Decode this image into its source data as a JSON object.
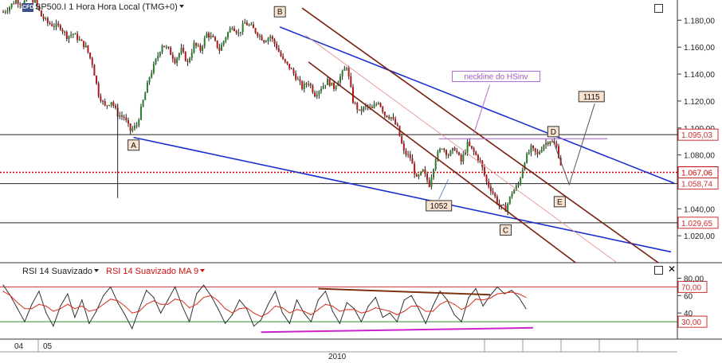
{
  "header": {
    "instrument": "SP500.I",
    "title": "SP500.I 1 Hora Hora Local (TMG+0)",
    "logo_text": "CFD"
  },
  "rsi_panel": {
    "rsi_label": "RSI 14 Suavizado",
    "rsi_ma_label": "RSI 14 Suavizado MA 9"
  },
  "colors": {
    "candle_up": "#2a7a2a",
    "candle_down": "#b01818",
    "trendline_blue": "#1a2fd0",
    "channel_brown": "#7a1f12",
    "rsi_line": "#333333",
    "rsi_ma_line": "#d83020",
    "rsi_trend_top": "#7a3410",
    "rsi_trend_bottom": "#cc22cc",
    "rsi_level_30": "#2f8f2f",
    "rsi_level_70": "#cc3030",
    "price_marker": "#cc0000",
    "neckline": "#b06ad8"
  },
  "chart_data": [
    {
      "type": "candlestick",
      "title": "SP500.I 1 Hora Hora Local (TMG+0)",
      "x_ticks": [
        "04",
        "05"
      ],
      "x_period": "2010",
      "ylim": [
        1000,
        1195
      ],
      "y_ticks": [
        1020,
        1040,
        1060,
        1080,
        1100,
        1120,
        1140,
        1160,
        1180
      ],
      "y_tick_labels": [
        "1.020,00",
        "1.040,00",
        "1.060,00",
        "1.080,00",
        "1.100,00",
        "1.120,00",
        "1.140,00",
        "1.160,00",
        "1.180,00"
      ],
      "price_tags": [
        {
          "label": "1.095,03",
          "value": 1095.03,
          "color": "#cc3030"
        },
        {
          "label": "1.067,06",
          "value": 1067.06,
          "color": "#cc0000"
        },
        {
          "label": "1.058,74",
          "value": 1058.74,
          "color": "#cc3030"
        },
        {
          "label": "1.029,65",
          "value": 1029.65,
          "color": "#cc3030"
        }
      ],
      "horizontal_lines": [
        1095.03,
        1058.74,
        1029.65
      ],
      "current_price_line": 1067.06,
      "close_path": [
        [
          0,
          1186
        ],
        [
          2,
          1190
        ],
        [
          4,
          1195
        ],
        [
          6,
          1192
        ],
        [
          8,
          1197
        ],
        [
          10,
          1194
        ],
        [
          12,
          1183
        ],
        [
          14,
          1178
        ],
        [
          16,
          1176
        ],
        [
          18,
          1175
        ],
        [
          20,
          1168
        ],
        [
          22,
          1170
        ],
        [
          24,
          1165
        ],
        [
          26,
          1160
        ],
        [
          28,
          1148
        ],
        [
          30,
          1125
        ],
        [
          32,
          1116
        ],
        [
          34,
          1120
        ],
        [
          36,
          1110
        ],
        [
          38,
          1108
        ],
        [
          40,
          1098
        ],
        [
          42,
          1102
        ],
        [
          44,
          1120
        ],
        [
          46,
          1138
        ],
        [
          48,
          1150
        ],
        [
          50,
          1162
        ],
        [
          52,
          1158
        ],
        [
          54,
          1150
        ],
        [
          56,
          1158
        ],
        [
          58,
          1148
        ],
        [
          60,
          1162
        ],
        [
          62,
          1158
        ],
        [
          64,
          1170
        ],
        [
          66,
          1166
        ],
        [
          68,
          1158
        ],
        [
          70,
          1168
        ],
        [
          72,
          1176
        ],
        [
          74,
          1170
        ],
        [
          76,
          1178
        ],
        [
          78,
          1175
        ],
        [
          80,
          1170
        ],
        [
          82,
          1165
        ],
        [
          84,
          1168
        ],
        [
          86,
          1160
        ],
        [
          88,
          1150
        ],
        [
          90,
          1145
        ],
        [
          92,
          1138
        ],
        [
          94,
          1130
        ],
        [
          96,
          1134
        ],
        [
          98,
          1125
        ],
        [
          100,
          1130
        ],
        [
          102,
          1135
        ],
        [
          104,
          1130
        ],
        [
          106,
          1138
        ],
        [
          108,
          1146
        ],
        [
          110,
          1120
        ],
        [
          112,
          1112
        ],
        [
          114,
          1116
        ],
        [
          116,
          1114
        ],
        [
          118,
          1120
        ],
        [
          120,
          1110
        ],
        [
          122,
          1108
        ],
        [
          124,
          1100
        ],
        [
          126,
          1082
        ],
        [
          128,
          1078
        ],
        [
          130,
          1062
        ],
        [
          132,
          1068
        ],
        [
          134,
          1058
        ],
        [
          136,
          1078
        ],
        [
          138,
          1086
        ],
        [
          140,
          1080
        ],
        [
          142,
          1085
        ],
        [
          144,
          1075
        ],
        [
          146,
          1088
        ],
        [
          148,
          1082
        ],
        [
          150,
          1075
        ],
        [
          152,
          1060
        ],
        [
          154,
          1052
        ],
        [
          156,
          1042
        ],
        [
          158,
          1040
        ],
        [
          160,
          1052
        ],
        [
          162,
          1058
        ],
        [
          164,
          1076
        ],
        [
          166,
          1085
        ],
        [
          168,
          1080
        ],
        [
          170,
          1088
        ],
        [
          172,
          1091
        ],
        [
          174,
          1086
        ],
        [
          176,
          1067
        ]
      ],
      "annotations": [
        {
          "text": "A",
          "x": 41,
          "y": 1087,
          "boxed": true
        },
        {
          "text": "B",
          "x": 87,
          "y": 1186,
          "boxed": true
        },
        {
          "text": "C",
          "x": 158,
          "y": 1024,
          "boxed": true
        },
        {
          "text": "D",
          "x": 173,
          "y": 1097,
          "boxed": true
        },
        {
          "text": "E",
          "x": 175,
          "y": 1045,
          "boxed": true
        },
        {
          "text": "1052",
          "x": 137,
          "y": 1042,
          "boxed": true
        },
        {
          "text": "1115",
          "x": 185,
          "y": 1123,
          "boxed": true
        },
        {
          "text": "neckline do HSinv",
          "x": 155,
          "y": 1138,
          "boxed": true
        }
      ],
      "trendlines": [
        {
          "name": "blue-upper",
          "from": [
            87,
            1175
          ],
          "to": [
            211,
            1059
          ]
        },
        {
          "name": "blue-lower",
          "from": [
            41,
            1093
          ],
          "to": [
            210,
            1008
          ]
        },
        {
          "name": "channel-upper",
          "from": [
            94,
            1189
          ],
          "to": [
            206,
            1000
          ]
        },
        {
          "name": "channel-lower",
          "from": [
            96,
            1149
          ],
          "to": [
            180,
            1000
          ]
        },
        {
          "name": "neckline",
          "from": [
            137,
            1092
          ],
          "to": [
            190,
            1092
          ]
        }
      ]
    },
    {
      "type": "line",
      "title": "RSI 14 Suavizado",
      "ylim": [
        10,
        85
      ],
      "y_ticks": [
        40,
        60,
        80
      ],
      "y_tick_labels": [
        "40",
        "60",
        "80,00"
      ],
      "levels": [
        {
          "label": "70,00",
          "value": 70
        },
        {
          "label": "30,00",
          "value": 30
        }
      ],
      "series": [
        {
          "name": "RSI 14 Suavizado",
          "values": [
            72,
            60,
            45,
            30,
            50,
            65,
            40,
            25,
            48,
            62,
            35,
            55,
            28,
            42,
            60,
            70,
            52,
            38,
            22,
            45,
            66,
            58,
            40,
            55,
            70,
            48,
            30,
            62,
            72,
            60,
            45,
            28,
            38,
            55,
            45,
            25,
            32,
            50,
            65,
            40,
            28,
            55,
            40,
            30,
            55,
            65,
            42,
            28,
            52,
            45,
            30,
            48,
            58,
            35,
            40,
            30,
            55,
            60,
            45,
            28,
            48,
            65,
            55,
            38,
            30,
            58,
            68,
            48,
            60,
            70,
            62,
            66,
            58,
            45
          ]
        },
        {
          "name": "RSI 14 Suavizado MA 9",
          "values": [
            65,
            60,
            52,
            45,
            45,
            50,
            48,
            42,
            45,
            50,
            45,
            48,
            42,
            44,
            50,
            56,
            54,
            48,
            40,
            42,
            50,
            54,
            50,
            50,
            56,
            54,
            46,
            50,
            58,
            60,
            54,
            45,
            40,
            45,
            46,
            40,
            36,
            40,
            48,
            46,
            40,
            44,
            42,
            38,
            44,
            50,
            48,
            42,
            44,
            44,
            40,
            42,
            46,
            44,
            42,
            38,
            42,
            48,
            48,
            42,
            42,
            50,
            54,
            50,
            44,
            48,
            56,
            55,
            57,
            62,
            63,
            64,
            62,
            58
          ]
        }
      ],
      "trendlines": [
        {
          "name": "rsi-top",
          "from": [
            44,
            68
          ],
          "to": [
            68,
            61
          ]
        },
        {
          "name": "rsi-bottom",
          "from": [
            36,
            18
          ],
          "to": [
            74,
            23
          ]
        }
      ]
    }
  ]
}
